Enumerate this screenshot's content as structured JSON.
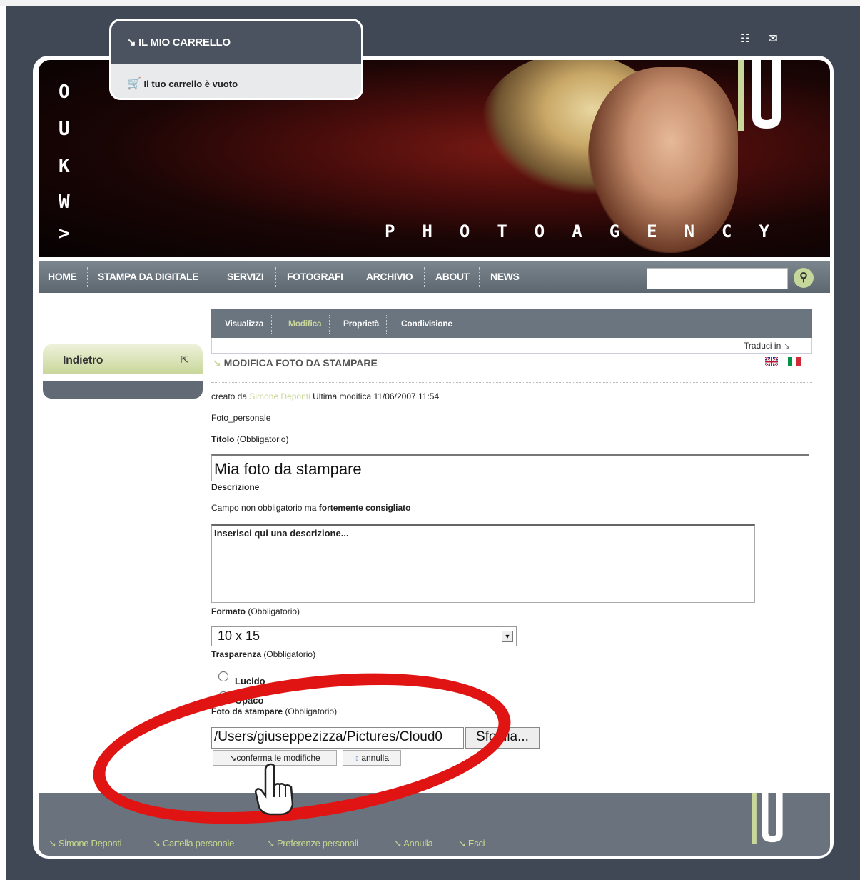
{
  "cart": {
    "title": "IL MIO CARRELLO",
    "empty_text": "Il tuo carrello è vuoto"
  },
  "banner": {
    "side_letters": [
      "O",
      "U",
      "K",
      "W",
      ">"
    ],
    "brand": "PHOTOAGENCY"
  },
  "nav": {
    "items": [
      "HOME",
      "STAMPA DA DIGITALE",
      "SERVIZI",
      "FOTOGRAFI",
      "ARCHIVIO",
      "ABOUT",
      "NEWS"
    ],
    "search_placeholder": ""
  },
  "sidebar": {
    "back_label": "Indietro",
    "back_arrow": "⇱"
  },
  "tabs": {
    "items": [
      "Visualizza",
      "Modifica",
      "Proprietà",
      "Condivisione"
    ],
    "active": "Modifica"
  },
  "translate": {
    "label": "Traduci in",
    "arrow": "↘",
    "flags": [
      "UK",
      "IT"
    ]
  },
  "page": {
    "title": "MODIFICA FOTO DA STAMPARE"
  },
  "meta": {
    "created_by_prefix": "creato da",
    "author": "Simone Deponti",
    "last_mod_label": "Ultima modifica",
    "last_mod_date": "11/06/2007 11:54"
  },
  "object_type": "Foto_personale",
  "form": {
    "titolo_label": "Titolo",
    "required": "(Obbligatorio)",
    "titolo_value": "Mia foto da stampare",
    "descr_label": "Descrizione",
    "descr_help_prefix": "Campo non obbligatorio ma",
    "descr_help_bold": "fortemente consigliato",
    "descr_value": "Inserisci qui una descrizione...",
    "formato_label": "Formato",
    "formato_value": "10 x 15",
    "trasp_label": "Trasparenza",
    "trasp_options": [
      "Lucido",
      "Opaco"
    ],
    "foto_label": "Foto da stampare",
    "file_value": "/Users/giuseppezizza/Pictures/Cloud0",
    "browse_label": "Sfoglia...",
    "confirm_label": "conferma le modifiche",
    "cancel_label": "annulla"
  },
  "footer": {
    "links": [
      "Simone Deponti",
      "Cartella personale",
      "Preferenze personali",
      "Annulla",
      "Esci"
    ]
  },
  "colors": {
    "frame": "#3f4854",
    "accent_green": "#c9d79b",
    "nav": "#6a757f",
    "annotation_red": "#e11414"
  }
}
